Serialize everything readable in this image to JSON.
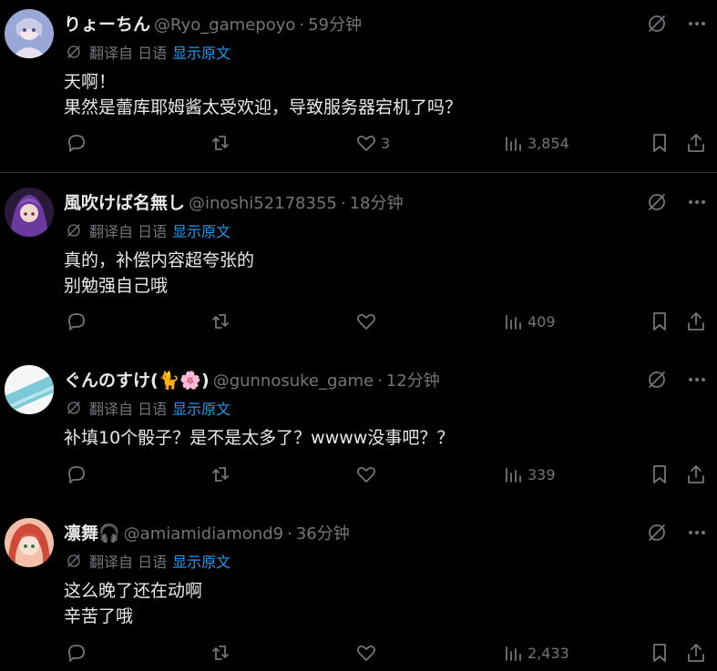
{
  "colors": {
    "background": "#000000",
    "text": "#e7e9ea",
    "secondary": "#71767b",
    "link": "#1d9bf0",
    "divider": "#2f3336"
  },
  "icons": {
    "reply": "speech-bubble-icon",
    "repost": "repost-arrows-icon",
    "like": "heart-icon",
    "views": "bar-chart-icon",
    "bookmark": "bookmark-icon",
    "share": "share-upload-icon",
    "grok": "grok-slash-circle-icon",
    "more": "ellipsis-icon",
    "translate": "translate-slash-circle-icon"
  },
  "tweets": [
    {
      "name": "りょーちん",
      "handle": "@Ryo_gamepoyo",
      "sep": "·",
      "time": "59分钟",
      "translated_from": "翻译自 日语",
      "show_original": "显示原文",
      "lines": [
        "天啊！",
        "果然是蕾库耶姆酱太受欢迎，导致服务器宕机了吗？"
      ],
      "reply_count": "",
      "repost_count": "",
      "like_count": "3",
      "view_count": "3,854",
      "avatar_color": "#8b9bd0"
    },
    {
      "name": "風吹けば名無し",
      "handle": "@inoshi52178355",
      "sep": "·",
      "time": "18分钟",
      "translated_from": "翻译自 日语",
      "show_original": "显示原文",
      "lines": [
        "真的，补偿内容超夸张的",
        "别勉强自己哦"
      ],
      "reply_count": "",
      "repost_count": "",
      "like_count": "",
      "view_count": "409",
      "avatar_color": "#5a3a8a"
    },
    {
      "name": "ぐんのすけ(🐈🌸)",
      "handle": "@gunnosuke_game",
      "sep": "·",
      "time": "12分钟",
      "translated_from": "翻译自 日语",
      "show_original": "显示原文",
      "lines": [
        "补填10个骰子？是不是太多了？wwww没事吧？？"
      ],
      "reply_count": "",
      "repost_count": "",
      "like_count": "",
      "view_count": "339",
      "avatar_color": "#7cc9d8"
    },
    {
      "name": "凛舞🎧",
      "handle": "@amiamidiamond9",
      "sep": "·",
      "time": "36分钟",
      "translated_from": "翻译自 日语",
      "show_original": "显示原文",
      "lines": [
        "这么晚了还在动啊",
        "辛苦了哦"
      ],
      "reply_count": "",
      "repost_count": "",
      "like_count": "",
      "view_count": "2,433",
      "avatar_color": "#d04a3a"
    }
  ]
}
